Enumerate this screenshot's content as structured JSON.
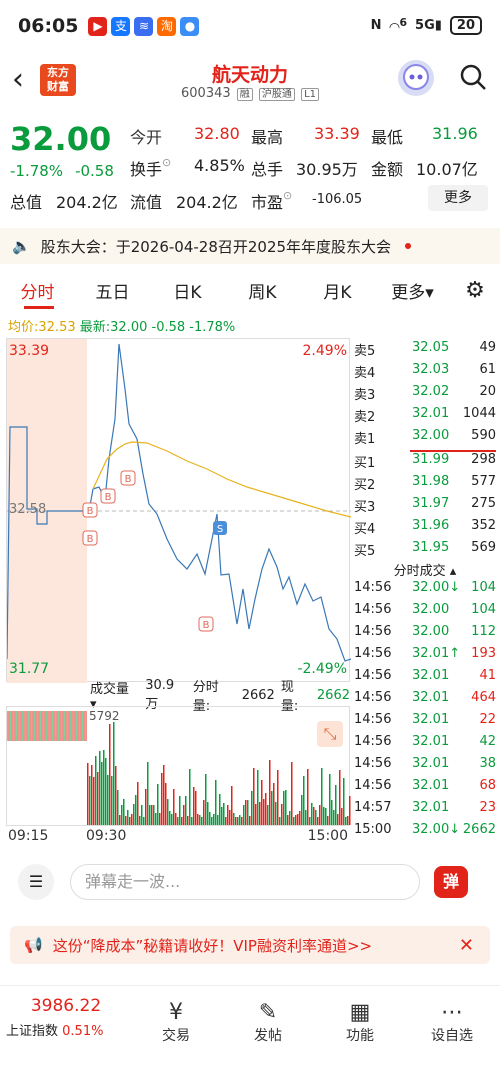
{
  "status": {
    "time": "06:05",
    "net": "5G",
    "signal": "6",
    "battery": "20"
  },
  "stock": {
    "name": "航天动力",
    "code": "600343",
    "tags": [
      "融",
      "沪股通",
      "L1"
    ],
    "logo": "东方\n财富"
  },
  "quote": {
    "price": "32.00",
    "chg_pct": "-1.78%",
    "chg": "-0.58",
    "open_l": "今开",
    "open": "32.80",
    "high_l": "最高",
    "high": "33.39",
    "low_l": "最低",
    "low": "31.96",
    "turn_l": "换手",
    "turn": "4.85%",
    "vol_l": "总手",
    "vol": "30.95万",
    "amt_l": "金额",
    "amt": "10.07亿",
    "mcap_l": "总值",
    "mcap": "204.2亿",
    "fcap_l": "流值",
    "fcap": "204.2亿",
    "pe_l": "市盈",
    "pe": "-106.05",
    "more": "更多"
  },
  "notice": "股东大会：于2026-04-28召开2025年年度股东大会",
  "tabs": [
    "分时",
    "五日",
    "日K",
    "周K",
    "月K",
    "更多"
  ],
  "avg": {
    "label": "均价:",
    "value": "32.53",
    "latest_l": "最新:",
    "latest": "32.00",
    "chg": "-0.58",
    "pct": "-1.78%"
  },
  "axis": {
    "top": "33.39",
    "bottom": "31.77",
    "mid": "32.58",
    "ptop": "2.49%",
    "pbot": "-2.49%",
    "t_start": "09:15",
    "t_mid": "09:30",
    "t_end": "15:00"
  },
  "orderbook": {
    "asks": [
      {
        "l": "卖5",
        "p": "32.05",
        "v": "49"
      },
      {
        "l": "卖4",
        "p": "32.03",
        "v": "61"
      },
      {
        "l": "卖3",
        "p": "32.02",
        "v": "20"
      },
      {
        "l": "卖2",
        "p": "32.01",
        "v": "1044"
      },
      {
        "l": "卖1",
        "p": "32.00",
        "v": "590"
      }
    ],
    "bids": [
      {
        "l": "买1",
        "p": "31.99",
        "v": "298"
      },
      {
        "l": "买2",
        "p": "31.98",
        "v": "577"
      },
      {
        "l": "买3",
        "p": "31.97",
        "v": "275"
      },
      {
        "l": "买4",
        "p": "31.96",
        "v": "352"
      },
      {
        "l": "买5",
        "p": "31.95",
        "v": "569"
      }
    ]
  },
  "ticks_title": "分时成交",
  "ticks": [
    {
      "t": "14:56",
      "p": "32.00",
      "a": "↓",
      "v": "104",
      "c": "g"
    },
    {
      "t": "14:56",
      "p": "32.00",
      "a": "",
      "v": "104",
      "c": "g"
    },
    {
      "t": "14:56",
      "p": "32.00",
      "a": "",
      "v": "112",
      "c": "g"
    },
    {
      "t": "14:56",
      "p": "32.01",
      "a": "↑",
      "v": "193",
      "c": "r"
    },
    {
      "t": "14:56",
      "p": "32.01",
      "a": "",
      "v": "41",
      "c": "r"
    },
    {
      "t": "14:56",
      "p": "32.01",
      "a": "",
      "v": "464",
      "c": "r"
    },
    {
      "t": "14:56",
      "p": "32.01",
      "a": "",
      "v": "22",
      "c": "r"
    },
    {
      "t": "14:56",
      "p": "32.01",
      "a": "",
      "v": "42",
      "c": "g"
    },
    {
      "t": "14:56",
      "p": "32.01",
      "a": "",
      "v": "38",
      "c": "g"
    },
    {
      "t": "14:56",
      "p": "32.01",
      "a": "",
      "v": "68",
      "c": "r"
    },
    {
      "t": "14:57",
      "p": "32.01",
      "a": "",
      "v": "23",
      "c": "r"
    },
    {
      "t": "15:00",
      "p": "32.00",
      "a": "↓",
      "v": "2662",
      "c": "g"
    }
  ],
  "volume": {
    "label": "成交量",
    "total": "30.9万",
    "ft_l": "分时量:",
    "ft": "2662",
    "xl_l": "现量:",
    "xl": "2662",
    "max": "5792"
  },
  "danmu": {
    "placeholder": "弹幕走一波...",
    "btn": "弹"
  },
  "promo": "这份“降成本”秘籍请收好！VIP融资利率通道>>",
  "bottom": {
    "index_val": "3986.22",
    "index_name": "上证指数",
    "index_pct": "0.51%",
    "items": [
      "交易",
      "发帖",
      "功能",
      "设自选"
    ]
  }
}
